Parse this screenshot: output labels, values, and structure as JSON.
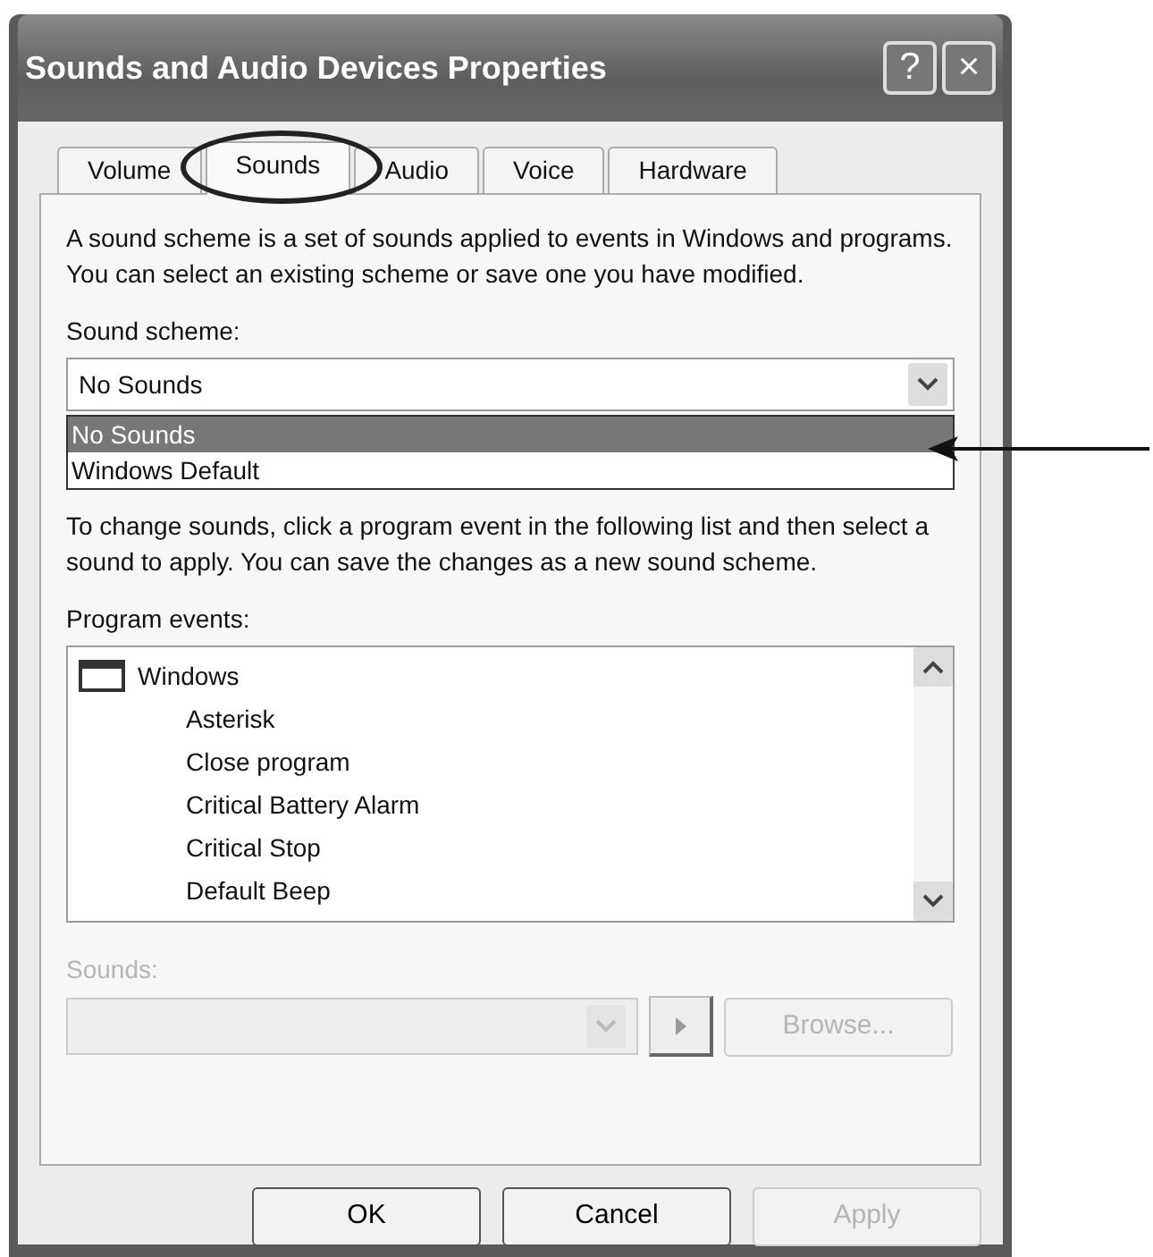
{
  "window": {
    "title": "Sounds and Audio Devices Properties",
    "buttons": [
      "?",
      "×"
    ]
  },
  "tabs": [
    {
      "label": "Volume",
      "selected": false,
      "circled": false
    },
    {
      "label": "Sounds",
      "selected": true,
      "circled": true
    },
    {
      "label": "Audio",
      "selected": false,
      "circled": false
    },
    {
      "label": "Voice",
      "selected": false,
      "circled": false
    },
    {
      "label": "Hardware",
      "selected": false,
      "circled": false
    }
  ],
  "intro": "A sound scheme is a set of sounds applied to events in Windows and programs. You can select an existing scheme or save one you have modified.",
  "scheme": {
    "label": "Sound scheme:",
    "value": "No Sounds",
    "expanded": true,
    "pointed_at": true,
    "options": [
      {
        "label": "No Sounds",
        "selected": true
      },
      {
        "label": "Windows Default",
        "selected": false
      }
    ]
  },
  "instructions": "To change sounds, click a program event in the following list and then select a sound to apply. You can save the changes as a new sound scheme.",
  "events": {
    "label": "Program events:",
    "items": [
      {
        "label": "Windows",
        "children": [
          {
            "label": "Asterisk"
          },
          {
            "label": "Close program"
          },
          {
            "label": "Critical Battery Alarm"
          },
          {
            "label": "Critical Stop"
          },
          {
            "label": "Default Beep"
          }
        ]
      }
    ]
  },
  "sounds": {
    "label": "Sounds:",
    "disabled": true,
    "browse": "Browse..."
  },
  "buttons": [
    {
      "label": "OK",
      "disabled": false
    },
    {
      "label": "Cancel",
      "disabled": false
    },
    {
      "label": "Apply",
      "disabled": true
    }
  ]
}
